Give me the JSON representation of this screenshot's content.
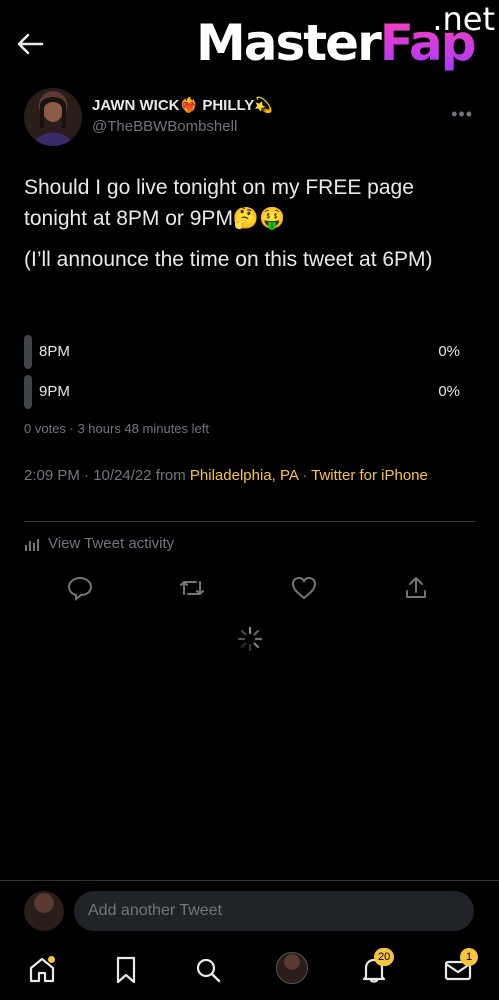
{
  "header": {
    "back_icon": "arrow-left-icon",
    "watermark": {
      "main": "Master",
      "accent": "Fap",
      "suffix": ".net"
    }
  },
  "tweet": {
    "author_name": "JAWN WICK❤️‍🔥 PHILLY💫",
    "handle": "@TheBBWBombshell",
    "more_icon": "more-options-icon",
    "text_line1": "Should I go live tonight on my FREE page tonight at 8PM or 9PM🤔🤑",
    "text_line2": "(I’ll announce the time on this tweet at 6PM)",
    "poll": {
      "options": [
        {
          "label": "8PM",
          "percent": "0%",
          "fraction": 0
        },
        {
          "label": "9PM",
          "percent": "0%",
          "fraction": 0
        }
      ],
      "meta": "0 votes · 3 hours 48 minutes left"
    },
    "time": "2:09 PM · 10/24/22 from",
    "location": "Philadelphia, PA",
    "separator": "·",
    "client": "Twitter for iPhone",
    "activity_label": "View Tweet activity",
    "actions": [
      "reply-icon",
      "retweet-icon",
      "like-icon",
      "share-icon"
    ]
  },
  "reply": {
    "placeholder": "Add another Tweet"
  },
  "nav": {
    "items": [
      "home-icon",
      "bookmark-icon",
      "search-icon",
      "profile-icon",
      "notifications-icon",
      "messages-icon"
    ],
    "notifications_badge": "20",
    "messages_badge": "1"
  },
  "colors": {
    "background": "#000000",
    "text": "#e7e9ea",
    "muted": "#71767b",
    "accent": "#f5c542"
  }
}
